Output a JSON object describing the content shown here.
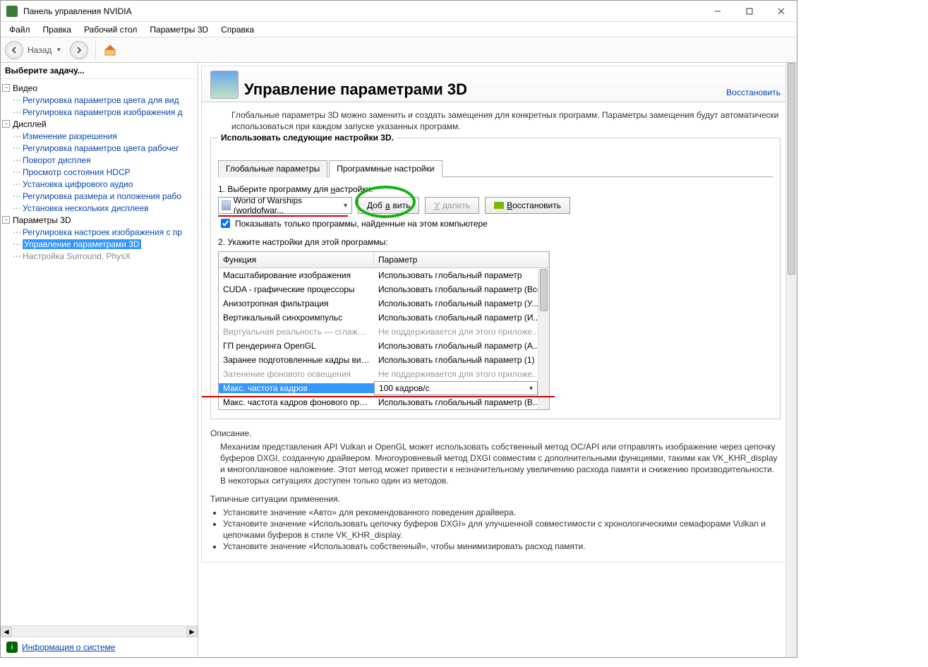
{
  "window": {
    "title": "Панель управления NVIDIA"
  },
  "menubar": [
    "Файл",
    "Правка",
    "Рабочий стол",
    "Параметры 3D",
    "Справка"
  ],
  "toolbar": {
    "back": "Назад"
  },
  "sidebar": {
    "task_title": "Выберите задачу...",
    "cats": {
      "video": "Видео",
      "display": "Дисплей",
      "params3d": "Параметры 3D"
    },
    "video_items": [
      "Регулировка параметров цвета для вид",
      "Регулировка параметров изображения д"
    ],
    "display_items": [
      "Изменение разрешения",
      "Регулировка параметров цвета рабочег",
      "Поворот дисплея",
      "Просмотр состояния HDCP",
      "Установка цифрового аудио",
      "Регулировка размера и положения рабо",
      "Установка нескольких дисплеев"
    ],
    "p3d_items": [
      "Регулировка настроек изображения с пр",
      "Управление параметрами 3D",
      "Настройка Surround, PhysX"
    ],
    "sysinfo": "Информация о системе"
  },
  "page": {
    "title": "Управление параметрами 3D",
    "restore": "Восстановить",
    "desc": "Глобальные параметры 3D можно заменить и создать замещения для конкретных программ. Параметры замещения будут автоматически использоваться при каждом запуске указанных программ.",
    "group_legend": "Использовать следующие настройки 3D.",
    "tabs": {
      "global": "Глобальные параметры",
      "program": "Программные настройки"
    },
    "step1_pre": "1. Выберите программу для ",
    "step1_und": "н",
    "step1_post": "астройки:",
    "program_selected": "World of Warships (worldofwar...",
    "btn_add_pre": "Доб",
    "btn_add_und": "а",
    "btn_add_post": "вить",
    "btn_remove_und": "У",
    "btn_remove_post": "далить",
    "btn_restore_und": "В",
    "btn_restore_post": "осстановить",
    "chk_label": "Показывать только программы, найденные на этом компьютере",
    "step2": "2. Укажите настройки для этой программы:",
    "col_func": "Функция",
    "col_param": "Параметр",
    "rows": [
      {
        "f": "Масштабирование изображения",
        "p": "Использовать глобальный параметр",
        "d": false
      },
      {
        "f": "CUDA - графические процессоры",
        "p": "Использовать глобальный параметр (Все)",
        "d": false
      },
      {
        "f": "Анизотропная фильтрация",
        "p": "Использовать глобальный параметр (У...",
        "d": false
      },
      {
        "f": "Вертикальный синхроимпульс",
        "p": "Использовать глобальный параметр (И...",
        "d": false
      },
      {
        "f": "Виртуальная реальность — сглаживан...",
        "p": "Не поддерживается для этого приложе...",
        "d": true
      },
      {
        "f": "ГП рендеринга OpenGL",
        "p": "Использовать глобальный параметр (А...",
        "d": false
      },
      {
        "f": "Заранее подготовленные кадры вирту...",
        "p": "Использовать глобальный параметр (1)",
        "d": false
      },
      {
        "f": "Затенение фонового освещения",
        "p": "Не поддерживается для этого приложе...",
        "d": true
      }
    ],
    "sel_row": {
      "f": "Макс. частота кадров",
      "p": "100 кадров/с"
    },
    "after_row": {
      "f": "Макс. частота кадров фонового прило...",
      "p": "Использовать глобальный параметр (В..."
    },
    "descr_title": "Описание.",
    "descr_text": "Механизм представления API Vulkan и OpenGL может использовать собственный метод ОС/API или отправлять изображение через цепочку буферов DXGI, созданную драйвером. Многоуровневый метод DXGI совместим с дополнительными функциями, такими как VK_KHR_display и многоплановое наложение. Этот метод может привести к незначительному увеличению расхода памяти и снижению производительности. В некоторых ситуациях доступен только один из методов.",
    "typical_title": "Типичные ситуации применения.",
    "bullets": [
      "Установите значение «Авто» для рекомендованного поведения драйвера.",
      "Установите значение «Использовать цепочку буферов DXGI» для улучшенной совместимости с хронологическими семафорами Vulkan и цепочками буферов в стиле VK_KHR_display.",
      "Установите значение «Использовать собственный», чтобы минимизировать расход памяти."
    ]
  }
}
